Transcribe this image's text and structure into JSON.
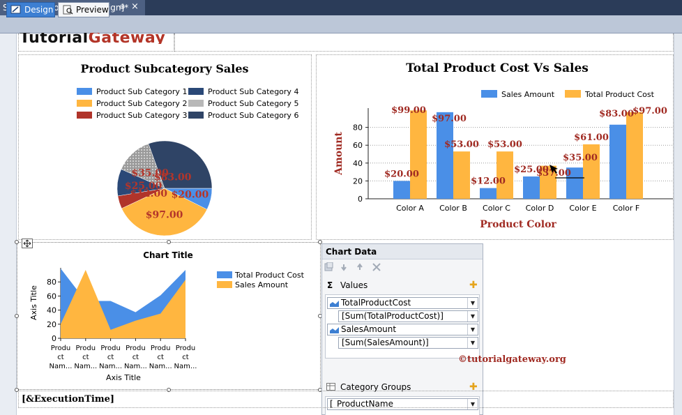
{
  "window": {
    "doc_tab_title": "SSRS Dashboard.rdl [Design]*",
    "pin_glyph": "⊕",
    "close_glyph": "×"
  },
  "mode_tabs": [
    {
      "label": "Design",
      "active": true
    },
    {
      "label": "Preview",
      "active": false
    }
  ],
  "logo": {
    "part1": "Tutorial",
    "part2": "Gateway"
  },
  "pie_chart": {
    "chart_data": {
      "type": "pie",
      "title": "Product Subcategory Sales",
      "legend": [
        "Product Sub Category 1",
        "Product Sub Category 2",
        "Product Sub Category 3",
        "Product Sub Category 4",
        "Product Sub Category 5",
        "Product Sub Category 6"
      ],
      "colors": [
        "#4a8fe7",
        "#ffb640",
        "#b0342a",
        "#2a4877",
        "#b8b8b8",
        "#2f4466"
      ],
      "values": [
        20,
        97,
        12,
        25,
        35,
        83
      ],
      "data_labels": [
        "$20.00",
        "$97.00",
        "$12.00",
        "$25.00",
        "$35.00",
        "$83.00"
      ]
    }
  },
  "bar_chart": {
    "chart_data": {
      "type": "bar",
      "title": "Total Product Cost Vs Sales",
      "xlabel": "Product Color",
      "ylabel": "Amount",
      "categories": [
        "Color A",
        "Color B",
        "Color C",
        "Color D",
        "Color E",
        "Color F"
      ],
      "ylim": [
        0,
        100
      ],
      "yticks": [
        0,
        20,
        40,
        60,
        80
      ],
      "series": [
        {
          "name": "Sales Amount",
          "color": "#4a8fe7",
          "values": [
            20,
            97,
            12,
            25,
            35,
            83
          ],
          "labels": [
            "$20.00",
            "$97.00",
            "$12.00",
            "$25.00",
            "$35.00",
            "$83.00"
          ]
        },
        {
          "name": "Total Product Cost",
          "color": "#ffb640",
          "values": [
            99,
            53,
            53,
            37,
            61,
            97
          ],
          "labels": [
            "$99.00",
            "$53.00",
            "$53.00",
            "$37.00",
            "$61.00",
            "$97.00"
          ]
        }
      ]
    }
  },
  "area_chart": {
    "chart_data": {
      "type": "area",
      "title": "Chart Title",
      "xlabel": "Axis Title",
      "ylabel": "Axis Title",
      "categories": [
        "Product Name",
        "Product Name",
        "Product Name",
        "Product Name",
        "Product Name",
        "Product Name"
      ],
      "category_lines": [
        "Produ",
        "ct",
        "Nam..."
      ],
      "ylim": [
        0,
        100
      ],
      "yticks": [
        0,
        20,
        40,
        60,
        80
      ],
      "series": [
        {
          "name": "Total Product Cost",
          "color": "#4a8fe7",
          "values": [
            99,
            53,
            53,
            37,
            61,
            97
          ]
        },
        {
          "name": "Sales Amount",
          "color": "#ffb640",
          "values": [
            20,
            97,
            12,
            25,
            35,
            83
          ]
        }
      ]
    }
  },
  "chart_data_panel": {
    "title": "Chart Data",
    "values_label": "Values",
    "values": [
      {
        "field": "TotalProductCost",
        "expr": "[Sum(TotalProductCost)]"
      },
      {
        "field": "SalesAmount",
        "expr": "[Sum(SalesAmount)]"
      }
    ],
    "category_groups_label": "Category Groups",
    "category_field": "ProductName"
  },
  "watermark": "©tutorialgateway.org",
  "footer_expression": "[&ExecutionTime]"
}
